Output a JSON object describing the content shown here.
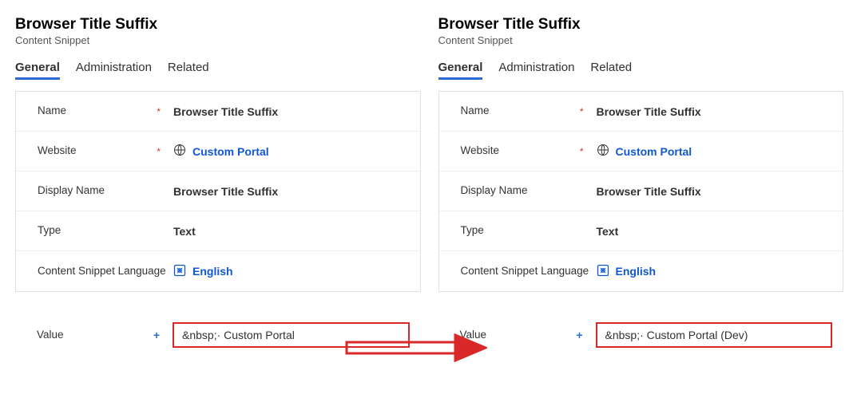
{
  "left": {
    "title": "Browser Title Suffix",
    "subtitle": "Content Snippet",
    "tabs": {
      "general": "General",
      "administration": "Administration",
      "related": "Related"
    },
    "fields": {
      "name_label": "Name",
      "name_value": "Browser Title Suffix",
      "website_label": "Website",
      "website_value": "Custom Portal",
      "display_name_label": "Display Name",
      "display_name_value": "Browser Title Suffix",
      "type_label": "Type",
      "type_value": "Text",
      "csl_label": "Content Snippet Language",
      "csl_value": "English",
      "value_label": "Value",
      "value_value": "&nbsp;· Custom Portal"
    }
  },
  "right": {
    "title": "Browser Title Suffix",
    "subtitle": "Content Snippet",
    "tabs": {
      "general": "General",
      "administration": "Administration",
      "related": "Related"
    },
    "fields": {
      "name_label": "Name",
      "name_value": "Browser Title Suffix",
      "website_label": "Website",
      "website_value": "Custom Portal",
      "display_name_label": "Display Name",
      "display_name_value": "Browser Title Suffix",
      "type_label": "Type",
      "type_value": "Text",
      "csl_label": "Content Snippet Language",
      "csl_value": "English",
      "value_label": "Value",
      "value_value": "&nbsp;· Custom Portal (Dev)"
    }
  }
}
